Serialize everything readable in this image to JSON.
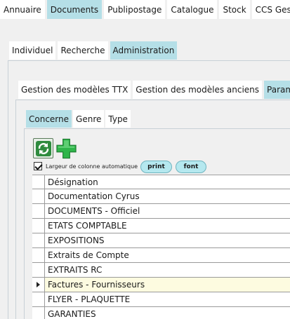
{
  "top_tabs": [
    {
      "label": "Annuaire",
      "active": false
    },
    {
      "label": "Documents",
      "active": true
    },
    {
      "label": "Publipostage",
      "active": false
    },
    {
      "label": "Catalogue",
      "active": false
    },
    {
      "label": "Stock",
      "active": false
    },
    {
      "label": "CCS Gestion",
      "active": false
    }
  ],
  "section_tabs": [
    {
      "label": "Individuel",
      "active": false
    },
    {
      "label": "Recherche",
      "active": false
    },
    {
      "label": "Administration",
      "active": true
    }
  ],
  "admin_tabs": [
    {
      "label": "Gestion des modèles TTX",
      "active": false
    },
    {
      "label": "Gestion des modèles anciens",
      "active": false
    },
    {
      "label": "Paramètres",
      "active": true
    }
  ],
  "param_tabs": [
    {
      "label": "Concerne",
      "active": true
    },
    {
      "label": "Genre",
      "active": false
    },
    {
      "label": "Type",
      "active": false
    }
  ],
  "toolbar": {
    "refresh_icon": "refresh-icon",
    "add_icon": "plus-icon",
    "auto_width_label": "Largeur de colonne automatique",
    "auto_width_checked": true,
    "print_label": "print",
    "font_label": "font"
  },
  "grid": {
    "header": "Désignation",
    "rows": [
      {
        "label": "Documentation Cyrus",
        "selected": false
      },
      {
        "label": "DOCUMENTS - Officiel",
        "selected": false
      },
      {
        "label": "ETATS COMPTABLE",
        "selected": false
      },
      {
        "label": "EXPOSITIONS",
        "selected": false
      },
      {
        "label": "Extraits de Compte",
        "selected": false
      },
      {
        "label": "EXTRAITS RC",
        "selected": false
      },
      {
        "label": "Factures - Fournisseurs",
        "selected": true
      },
      {
        "label": "FLYER - PLAQUETTE",
        "selected": false
      },
      {
        "label": "GARANTIES",
        "selected": false
      }
    ]
  },
  "colors": {
    "active_tab": "#b5dfe7",
    "selected_row": "#fdfbe0",
    "pill": "#b5e8ef"
  }
}
